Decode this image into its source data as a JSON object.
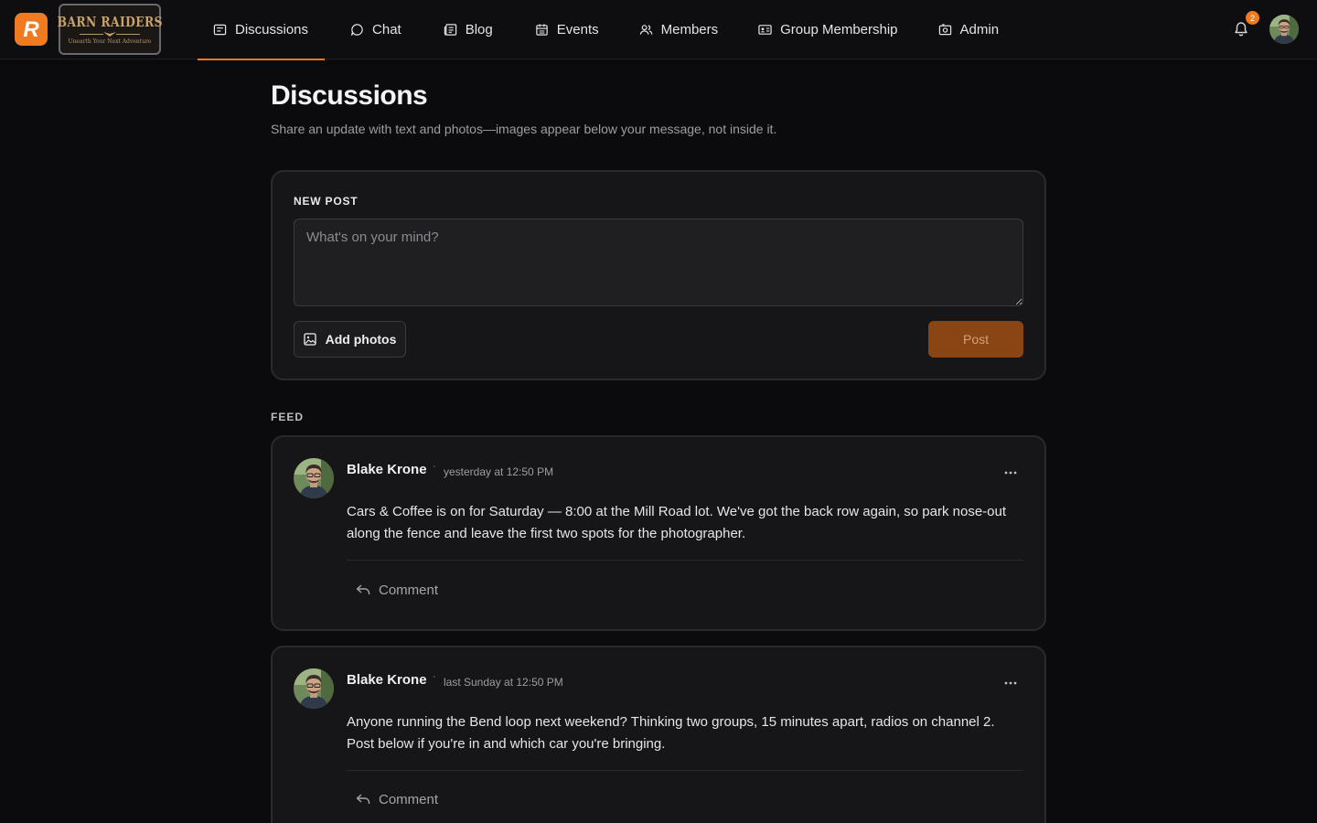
{
  "brand": {
    "logo_initial": "R",
    "logo_title": "BARN RAIDERS",
    "logo_tagline": "Unearth Your Next Adventure"
  },
  "nav": {
    "items": [
      {
        "label": "Discussions",
        "icon": "discussions-icon",
        "active": true
      },
      {
        "label": "Chat",
        "icon": "chat-icon"
      },
      {
        "label": "Blog",
        "icon": "blog-icon"
      },
      {
        "label": "Events",
        "icon": "calendar-icon"
      },
      {
        "label": "Members",
        "icon": "members-icon"
      },
      {
        "label": "Group Membership",
        "icon": "id-card-icon"
      },
      {
        "label": "Admin",
        "icon": "admin-icon"
      }
    ],
    "notifications_count": "2"
  },
  "page": {
    "title": "Discussions",
    "subtitle": "Share an update with text and photos—images appear below your message, not inside it."
  },
  "composer": {
    "label": "NEW POST",
    "placeholder": "What's on your mind?",
    "add_photos_label": "Add photos",
    "post_label": "Post"
  },
  "feed": {
    "label": "FEED",
    "posts": [
      {
        "author": "Blake Krone",
        "separator": "·",
        "time": "yesterday at 12:50 PM",
        "body": "Cars & Coffee is on for Saturday — 8:00 at the Mill Road lot. We've got the back row again, so park nose-out along the fence and leave the first two spots for the photographer.",
        "comment_label": "Comment"
      },
      {
        "author": "Blake Krone",
        "separator": "·",
        "time": "last Sunday at 12:50 PM",
        "body": "Anyone running the Bend loop next weekend? Thinking two groups, 15 minutes apart, radios on channel 2. Post below if you're in and which car you're bringing.",
        "comment_label": "Comment"
      }
    ]
  },
  "colors": {
    "accent": "#f07a1f",
    "post_button_bg": "#8a4514",
    "background": "#0b0b0d",
    "card": "#161618"
  }
}
